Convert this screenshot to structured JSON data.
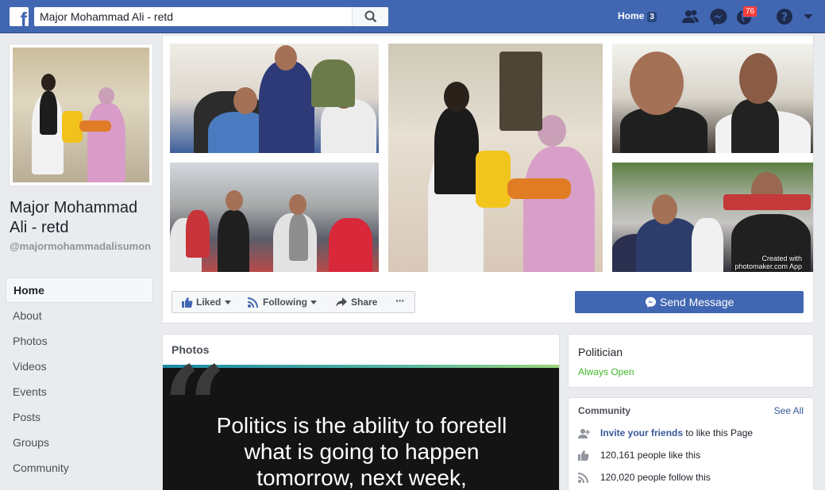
{
  "topbar": {
    "search_value": "Major Mohammad Ali - retd",
    "home_label": "Home",
    "home_count": "3",
    "notif_count": "76",
    "brand_color": "#4267b2"
  },
  "page": {
    "name": "Major Mohammad Ali - retd",
    "handle": "@majormohammadalisumon"
  },
  "left_nav": [
    {
      "label": "Home",
      "active": true
    },
    {
      "label": "About"
    },
    {
      "label": "Photos"
    },
    {
      "label": "Videos"
    },
    {
      "label": "Events"
    },
    {
      "label": "Posts"
    },
    {
      "label": "Groups"
    },
    {
      "label": "Community"
    }
  ],
  "cover": {
    "watermark_line1": "Created with",
    "watermark_line2": "photomaker.com App"
  },
  "actions": {
    "liked": "Liked",
    "following": "Following",
    "share": "Share",
    "more": "···",
    "send_message": "Send Message"
  },
  "photos_card": {
    "title": "Photos",
    "quote_mark": "“",
    "quote_text": "Politics is the ability to foretell what is going to happen tomorrow, next week,"
  },
  "about_card": {
    "category": "Politician",
    "hours": "Always Open",
    "hours_color": "#42b72a"
  },
  "community": {
    "title": "Community",
    "see_all": "See All",
    "invite_link": "Invite your friends",
    "invite_rest": " to like this Page",
    "likes": "120,161 people like this",
    "follows": "120,020 people follow this"
  }
}
